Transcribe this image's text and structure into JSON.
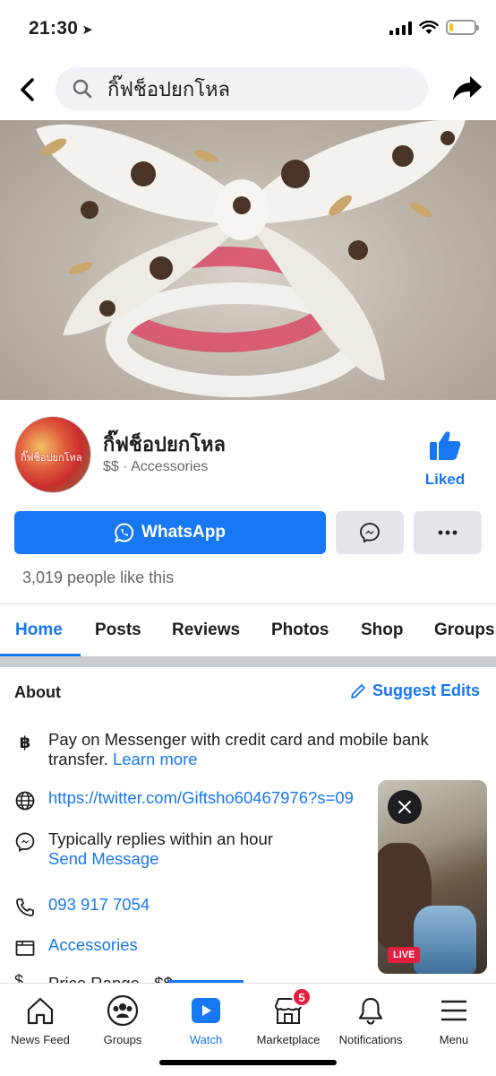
{
  "status_bar": {
    "time": "21:30",
    "battery_percent": 15
  },
  "search": {
    "query": "กิ๊ฟช็อปยกโหล"
  },
  "page": {
    "name": "กิ๊ฟช็อปยกโหล",
    "meta": "$$ · Accessories",
    "avatar_text": "กิ๊ฟช็อปยกโหล",
    "liked_label": "Liked",
    "likes_count": "3,019 people like this"
  },
  "actions": {
    "whatsapp_label": "WhatsApp"
  },
  "tabs": [
    {
      "label": "Home"
    },
    {
      "label": "Posts"
    },
    {
      "label": "Reviews"
    },
    {
      "label": "Photos"
    },
    {
      "label": "Shop"
    },
    {
      "label": "Groups"
    }
  ],
  "about": {
    "title": "About",
    "suggest_edits": "Suggest Edits",
    "payment": {
      "text": "Pay on Messenger with credit card and mobile bank transfer.",
      "link": "Learn more"
    },
    "website": "https://twitter.com/Giftsho60467976?s=09",
    "response": {
      "text": "Typically replies within an hour",
      "link": "Send Message"
    },
    "phone": "093 917 7054",
    "category": "Accessories",
    "price_range": "Price Range · $$"
  },
  "video": {
    "live_label": "LIVE"
  },
  "bottom_nav": [
    {
      "label": "News Feed",
      "icon": "home-icon"
    },
    {
      "label": "Groups",
      "icon": "groups-icon"
    },
    {
      "label": "Watch",
      "icon": "watch-icon"
    },
    {
      "label": "Marketplace",
      "icon": "marketplace-icon",
      "badge": "5"
    },
    {
      "label": "Notifications",
      "icon": "bell-icon"
    },
    {
      "label": "Menu",
      "icon": "menu-icon"
    }
  ],
  "colors": {
    "accent": "#1877f2",
    "badge": "#e41e3f"
  }
}
